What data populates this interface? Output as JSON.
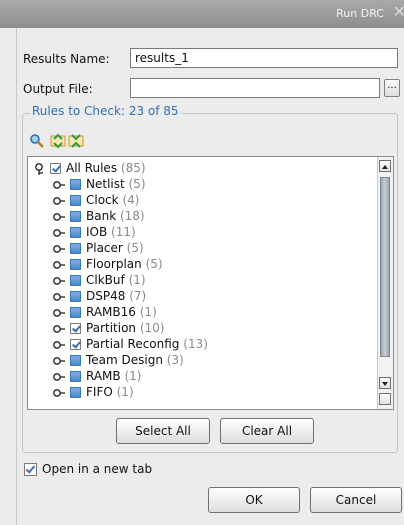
{
  "window": {
    "title": "Run DRC"
  },
  "results_name": {
    "label": "Results Name:",
    "value": "results_1"
  },
  "output_file": {
    "label": "Output File:",
    "value": "",
    "browse_label": "..."
  },
  "rules_group": {
    "title": "Rules to Check: 23 of 85"
  },
  "toolbar": {
    "icons": [
      "search-icon",
      "expand-all-icon",
      "collapse-all-icon"
    ]
  },
  "tree": {
    "root": {
      "label": "All Rules",
      "count": "(85)",
      "checked": true
    },
    "items": [
      {
        "label": "Netlist",
        "count": "(5)",
        "checked": false
      },
      {
        "label": "Clock",
        "count": "(4)",
        "checked": false
      },
      {
        "label": "Bank",
        "count": "(18)",
        "checked": false
      },
      {
        "label": "IOB",
        "count": "(11)",
        "checked": false
      },
      {
        "label": "Placer",
        "count": "(5)",
        "checked": false
      },
      {
        "label": "Floorplan",
        "count": "(5)",
        "checked": false
      },
      {
        "label": "ClkBuf",
        "count": "(1)",
        "checked": false
      },
      {
        "label": "DSP48",
        "count": "(7)",
        "checked": false
      },
      {
        "label": "RAMB16",
        "count": "(1)",
        "checked": false
      },
      {
        "label": "Partition",
        "count": "(10)",
        "checked": true
      },
      {
        "label": "Partial Reconfig",
        "count": "(13)",
        "checked": true
      },
      {
        "label": "Team Design",
        "count": "(3)",
        "checked": false
      },
      {
        "label": "RAMB",
        "count": "(1)",
        "checked": false
      },
      {
        "label": "FIFO",
        "count": "(1)",
        "checked": false
      }
    ]
  },
  "buttons": {
    "select_all": "Select All",
    "clear_all": "Clear All",
    "ok": "OK",
    "cancel": "Cancel"
  },
  "open_new_tab": {
    "label": "Open in a new tab",
    "checked": true
  },
  "colors": {
    "accent": "#2f6fb2",
    "titlebar": "#9a9a9a"
  }
}
